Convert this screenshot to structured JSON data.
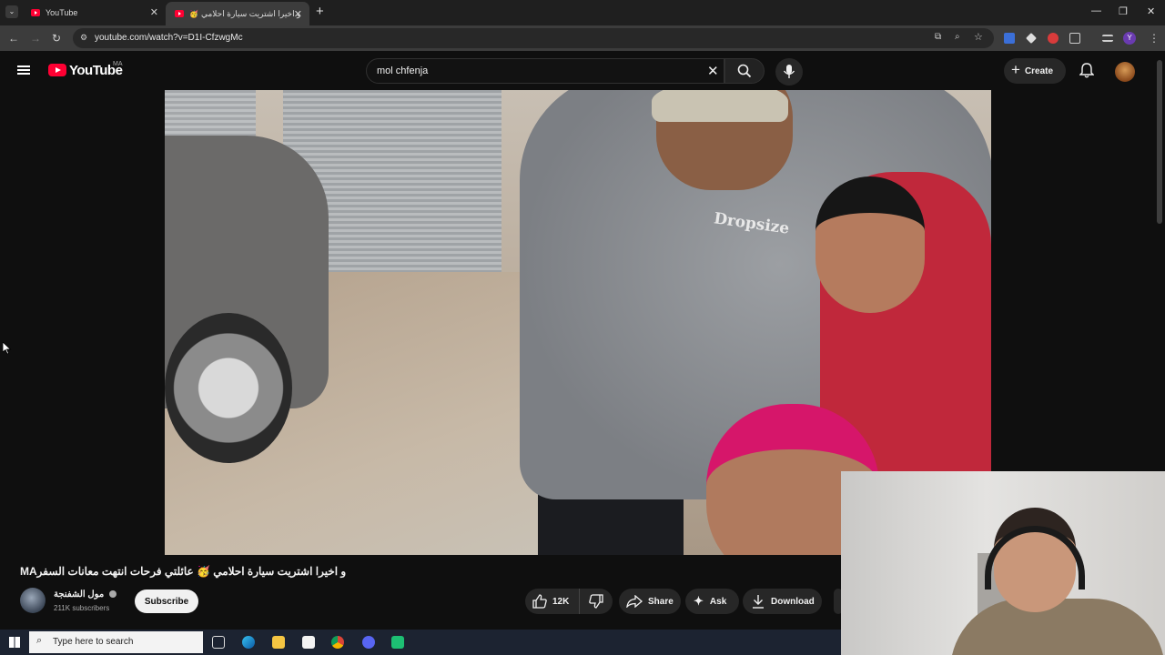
{
  "browser": {
    "tabs": [
      {
        "title": "YouTube",
        "active": false
      },
      {
        "title": "و اخيرا اشتريت سيارة احلامي",
        "active": true
      }
    ],
    "new_tab_label": "+",
    "url": "youtube.com/watch?v=D1I-CfzwgMc",
    "profile_initial": "Y"
  },
  "youtube": {
    "logo_text": "YouTube",
    "country_code": "MA",
    "search_value": "mol chfenja",
    "create_label": "Create"
  },
  "video": {
    "title": "MAو اخيرا اشتريت سيارة احلامي 🥳 عائلتي فرحات انتهت معانات السفر",
    "hoodie_text": "Dropsize"
  },
  "channel": {
    "name": "مول الشفنجة",
    "subscribers": "211K subscribers",
    "subscribe_label": "Subscribe"
  },
  "actions": {
    "like_count": "12K",
    "share_label": "Share",
    "ask_label": "Ask",
    "download_label": "Download"
  },
  "taskbar": {
    "search_placeholder": "Type here to search"
  },
  "colors": {
    "youtube_red": "#ff0033",
    "background": "#0f0f0f",
    "chip": "#272727"
  }
}
